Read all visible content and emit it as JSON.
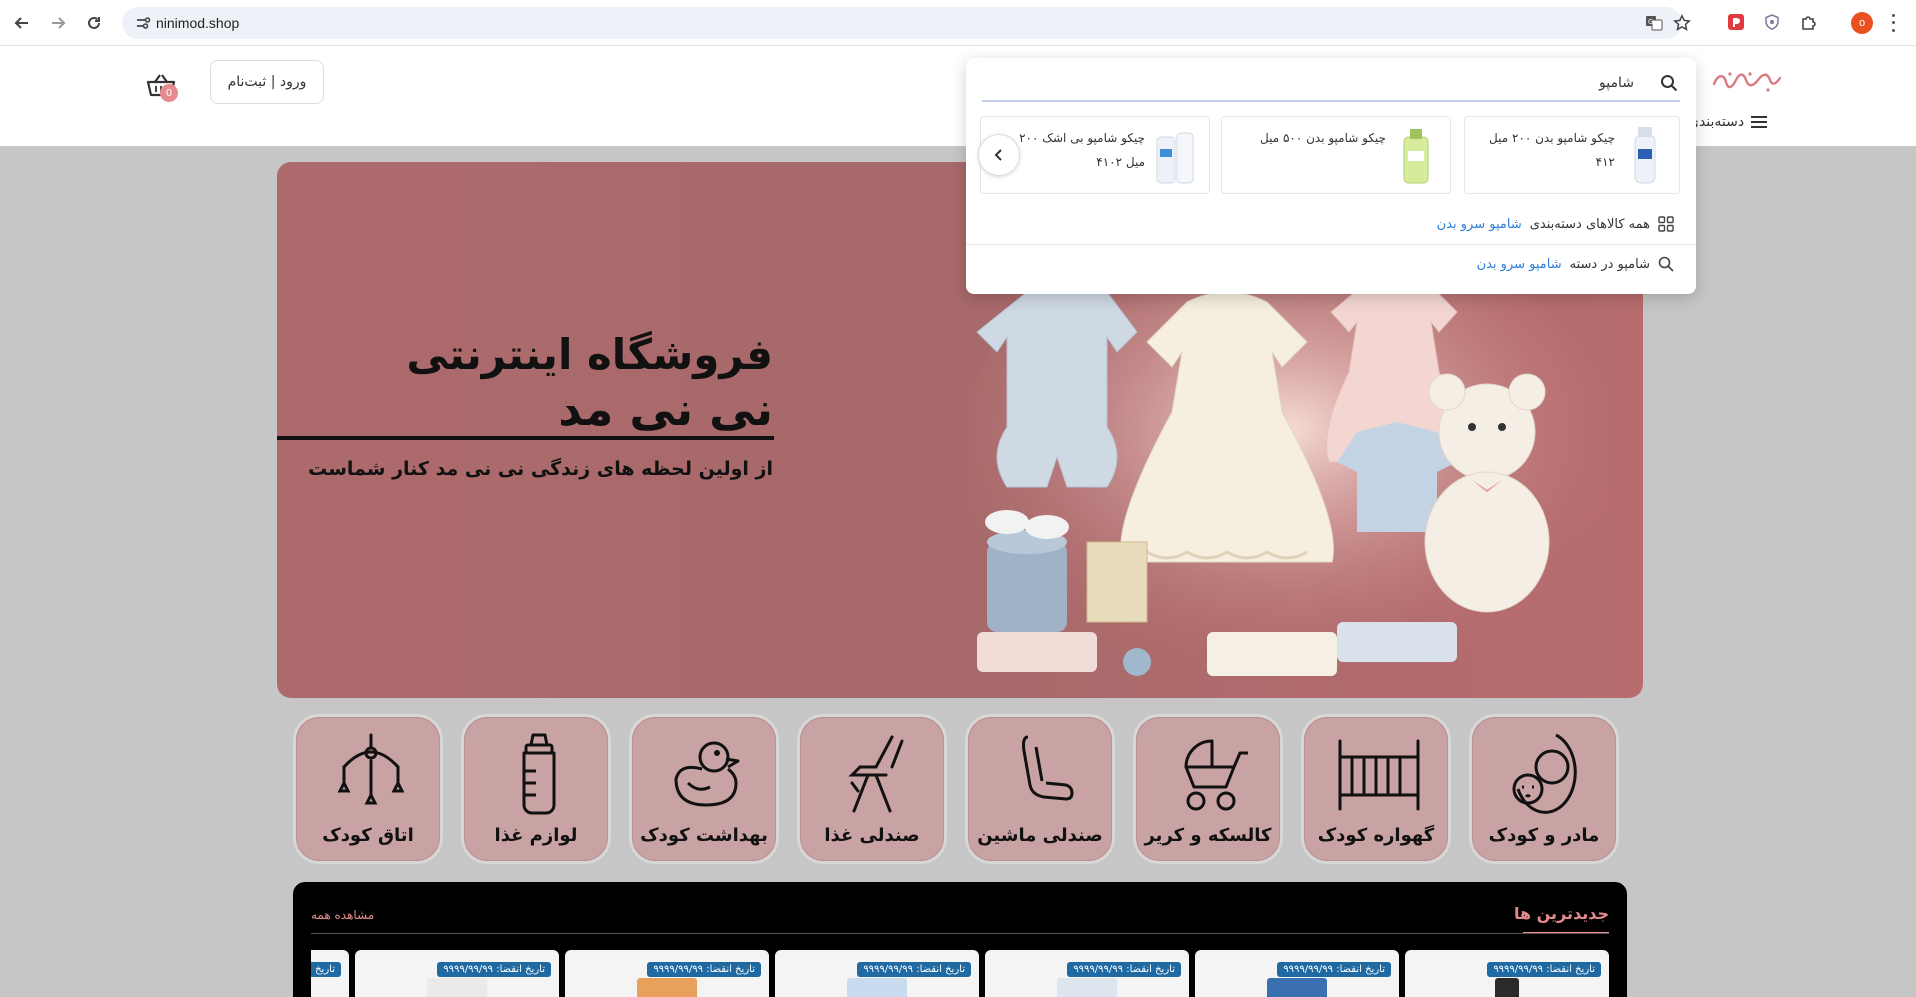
{
  "browser": {
    "url": "ninimod.shop",
    "profile_initial": "o"
  },
  "header": {
    "login_label": "ورود | ثبت‌نام",
    "cart_count": "0",
    "categories_label": "دسته‌بندی",
    "logo_text": "نی‌نی‌مد"
  },
  "search": {
    "query": "شامپو",
    "suggestions": [
      {
        "name": "چیکو شامپو بدن ۲۰۰ میل",
        "price": "۴۱۲"
      },
      {
        "name": "چیکو شامپو بدن ۵۰۰ میل",
        "price": ""
      },
      {
        "name": "چیکو شامپو بی اشک ۲۰۰",
        "price": "میل ۴۱۰۲"
      }
    ],
    "all_in_category_prefix": "همه کالاهای دسته‌بندی",
    "all_in_category_name": "شامپو سرو بدن",
    "search_in_category_prefix": "شامپو در دسته",
    "search_in_category_name": "شامپو سرو بدن"
  },
  "banner": {
    "title_line1": "فروشگاه اینترنتی",
    "title_line2": "نی نی مد",
    "subtitle": "از اولین لحظه های زندگی نی نی مد کنار شماست"
  },
  "categories": [
    {
      "label": "اتاق کودک",
      "icon": "baby-mobile-icon"
    },
    {
      "label": "لوازم غذا",
      "icon": "baby-bottle-icon"
    },
    {
      "label": "بهداشت کودک",
      "icon": "rubber-duck-icon"
    },
    {
      "label": "صندلی غذا",
      "icon": "high-chair-icon"
    },
    {
      "label": "صندلی ماشین",
      "icon": "car-seat-icon"
    },
    {
      "label": "کالسکه و کریر",
      "icon": "stroller-icon"
    },
    {
      "label": "گهواره کودک",
      "icon": "crib-icon"
    },
    {
      "label": "مادر و کودک",
      "icon": "mother-child-icon"
    }
  ],
  "newest": {
    "title": "جدیدترین ها",
    "see_all": "مشاهده همه",
    "expiry_label": "تاریخ انقضا: ۹۹۹۹/۹۹/۹۹",
    "expiry_partial": "تاریخ"
  },
  "colors": {
    "accent": "#e58b8e",
    "banner": "#ad6a6c",
    "category_card": "#c9a2a3",
    "link": "#2d7fd6",
    "badge": "#1f6aa3"
  }
}
